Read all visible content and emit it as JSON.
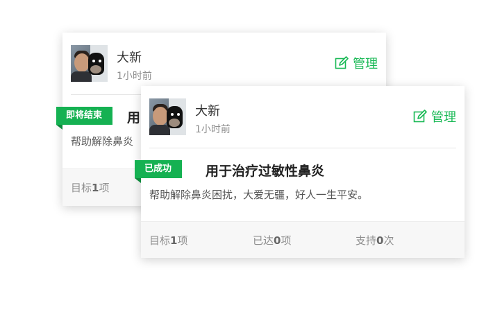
{
  "accent_color": "#15b152",
  "cards": [
    {
      "user": {
        "name": "大新",
        "time_ago": "1小时前"
      },
      "manage_label": "管理",
      "status": "即将结束",
      "title_partial": "用",
      "description_partial": "帮助解除鼻炎",
      "stats": {
        "target_label": "目标",
        "target_value": "1",
        "target_unit": "项"
      }
    },
    {
      "user": {
        "name": "大新",
        "time_ago": "1小时前"
      },
      "manage_label": "管理",
      "status": "已成功",
      "title": "用于治疗过敏性鼻炎",
      "description": "帮助解除鼻炎困扰，大爱无疆，好人一生平安。",
      "stats": {
        "target_label": "目标",
        "target_value": "1",
        "target_unit": "项",
        "achieved_label": "已达",
        "achieved_value": "0",
        "achieved_unit": "项",
        "support_label": "支持",
        "support_value": "0",
        "support_unit": "次"
      }
    }
  ]
}
